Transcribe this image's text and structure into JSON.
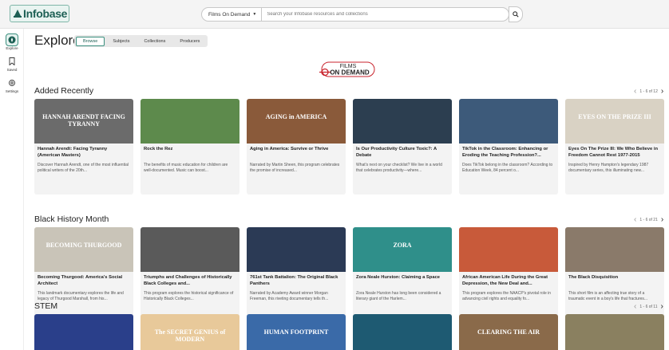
{
  "header": {
    "logo_text": "Infobase",
    "source_select": "Films On Demand",
    "search_placeholder": "Search your Infobase resources and collections"
  },
  "sidebar": {
    "items": [
      {
        "label": "Explore",
        "icon": "compass-icon"
      },
      {
        "label": "Saved",
        "icon": "bookmark-icon"
      },
      {
        "label": "Settings",
        "icon": "gear-icon"
      }
    ]
  },
  "main": {
    "title": "Explore",
    "tabs": [
      "Browse",
      "Subjects",
      "Collections",
      "Producers"
    ],
    "brand_top": "FILMS",
    "brand_bottom": "ON DEMAND"
  },
  "sections": [
    {
      "title": "Added Recently",
      "pager": "1 - 6 of 12",
      "cards": [
        {
          "title": "Hannah Arendt: Facing Tyranny (American Masters)",
          "desc": "Discover Hannah Arendt, one of the most influential political writers of the 20th...",
          "thumb_text": "HANNAH ARENDT FACING TYRANNY",
          "thumb_color": "#6b6b6b"
        },
        {
          "title": "Rock the Rez",
          "desc": "The benefits of music education for children are well-documented. Music can boost...",
          "thumb_text": "",
          "thumb_color": "#5d8a4c"
        },
        {
          "title": "Aging in America: Survive or Thrive",
          "desc": "Narrated by Martin Sheen, this program celebrates the promise of increased...",
          "thumb_text": "AGING in AMERICA",
          "thumb_color": "#8a5a3a"
        },
        {
          "title": "Is Our Productivity Culture Toxic?: A Debate",
          "desc": "What's next on your checklist? We live in a world that celebrates productivity—where...",
          "thumb_text": "",
          "thumb_color": "#2c3e50"
        },
        {
          "title": "TikTok in the Classroom: Enhancing or Eroding the Teaching Profession?...",
          "desc": "Does TikTok belong in the classroom? According to Education Week, 84 percent o...",
          "thumb_text": "",
          "thumb_color": "#3d5a7a"
        },
        {
          "title": "Eyes On The Prize III: We Who Believe in Freedom Cannot Rest 1977-2015",
          "desc": "Inspired by Henry Hampton's legendary 1987 documentary series, this illuminating new...",
          "thumb_text": "EYES ON THE PRIZE III",
          "thumb_color": "#d9d2c4"
        }
      ]
    },
    {
      "title": "Black History Month",
      "pager": "1 - 6 of 21",
      "cards": [
        {
          "title": "Becoming Thurgood: America's Social Architect",
          "desc": "This landmark documentary explores the life and legacy of Thurgood Marshall, from his...",
          "thumb_text": "BECOMING THURGOOD",
          "thumb_color": "#c9c4b8"
        },
        {
          "title": "Triumphs and Challenges of Historically Black Colleges and...",
          "desc": "This program explores the historical significance of Historically Black Colleges...",
          "thumb_text": "",
          "thumb_color": "#5a5a5a"
        },
        {
          "title": "761st Tank Battalion: The Original Black Panthers",
          "desc": "Narrated by Academy Award winner Morgan Freeman, this riveting documentary tells th...",
          "thumb_text": "",
          "thumb_color": "#2b3a55"
        },
        {
          "title": "Zora Neale Hurston: Claiming a Space",
          "desc": "Zora Neale Hurston has long been considered a literary giant of the Harlem...",
          "thumb_text": "ZORA",
          "thumb_color": "#2f8f8a"
        },
        {
          "title": "African American Life During the Great Depression, the New Deal and...",
          "desc": "This program explores the NAACP's pivotal role in advancing civil rights and equality fo...",
          "thumb_text": "",
          "thumb_color": "#c85a3a"
        },
        {
          "title": "The Black Disquisition",
          "desc": "This short film is an affecting true story of a traumatic event in a boy's life that fractures...",
          "thumb_text": "",
          "thumb_color": "#8a7a6a"
        }
      ]
    },
    {
      "title": "STEM",
      "pager": "1 - 6 of 11",
      "cards": [
        {
          "title": "",
          "desc": "",
          "thumb_text": "",
          "thumb_color": "#2a3f8a"
        },
        {
          "title": "",
          "desc": "",
          "thumb_text": "The SECRET GENIUS of MODERN",
          "thumb_color": "#e8c99a"
        },
        {
          "title": "",
          "desc": "",
          "thumb_text": "HUMAN FOOTPRINT",
          "thumb_color": "#3a6aa8"
        },
        {
          "title": "",
          "desc": "",
          "thumb_text": "",
          "thumb_color": "#1e5a72"
        },
        {
          "title": "",
          "desc": "",
          "thumb_text": "CLEARING THE AIR",
          "thumb_color": "#8a6a4a"
        },
        {
          "title": "",
          "desc": "",
          "thumb_text": "",
          "thumb_color": "#8a8060"
        }
      ]
    }
  ],
  "colors": {
    "accent": "#1c5f54",
    "brand_red": "#c8232c"
  }
}
